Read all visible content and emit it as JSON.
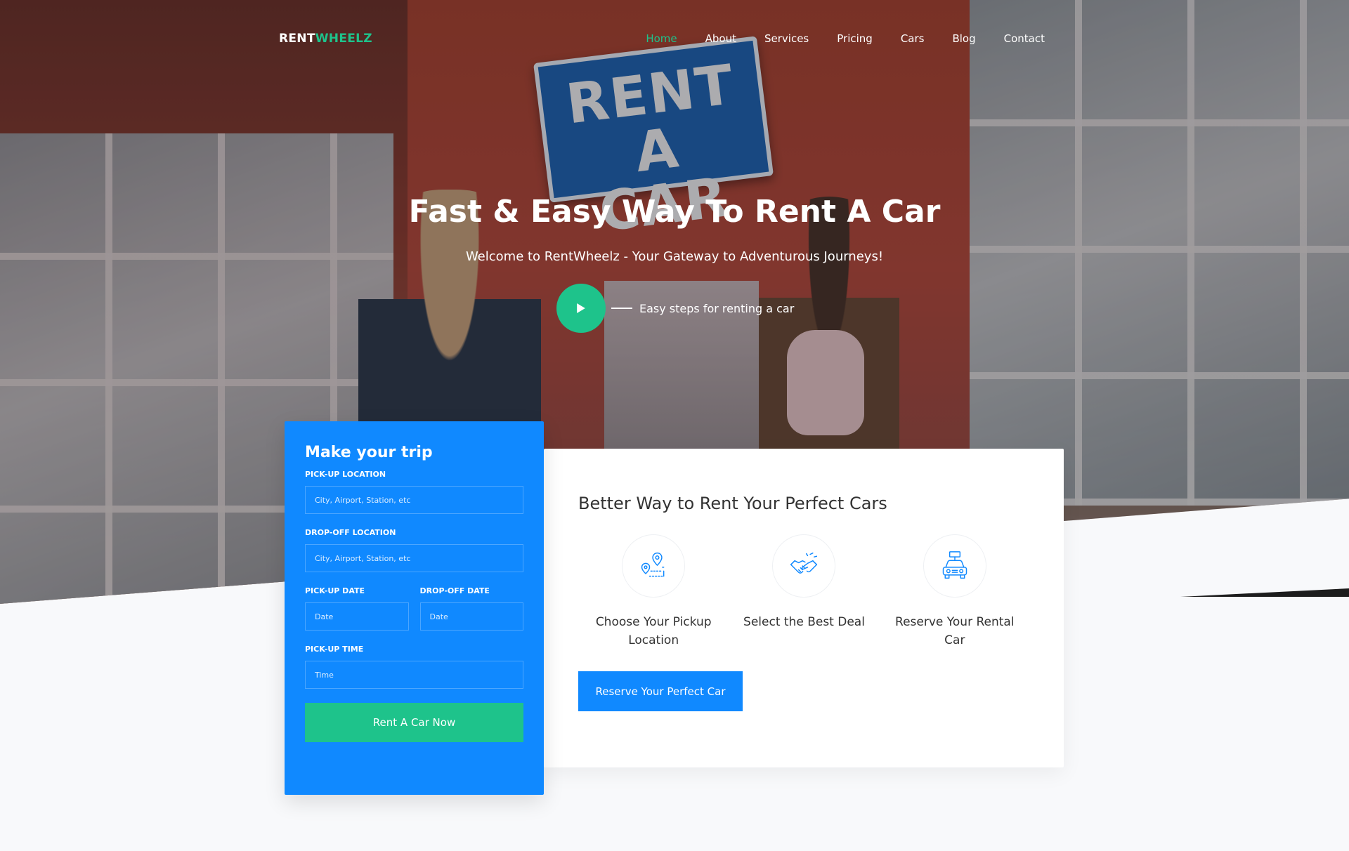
{
  "brand": {
    "name_part1": "RENT",
    "name_part2": "WHEELZ"
  },
  "nav": {
    "items": [
      {
        "label": "Home",
        "active": true
      },
      {
        "label": "About"
      },
      {
        "label": "Services"
      },
      {
        "label": "Pricing"
      },
      {
        "label": "Cars"
      },
      {
        "label": "Blog"
      },
      {
        "label": "Contact"
      }
    ]
  },
  "hero": {
    "sign_line1": "RENT",
    "sign_line2": "A CAR",
    "title": "Fast & Easy Way To Rent A Car",
    "subtitle": "Welcome to RentWheelz - Your Gateway to Adventurous Journeys!",
    "video_text": "Easy steps for renting a car",
    "play_icon": "play-icon"
  },
  "trip_form": {
    "title": "Make your trip",
    "pickup_location_label": "PICK-UP LOCATION",
    "pickup_location_placeholder": "City, Airport, Station, etc",
    "dropoff_location_label": "DROP-OFF LOCATION",
    "dropoff_location_placeholder": "City, Airport, Station, etc",
    "pickup_date_label": "PICK-UP DATE",
    "pickup_date_placeholder": "Date",
    "dropoff_date_label": "DROP-OFF DATE",
    "dropoff_date_placeholder": "Date",
    "pickup_time_label": "PICK-UP TIME",
    "pickup_time_placeholder": "Time",
    "submit_label": "Rent A Car Now"
  },
  "steps": {
    "title": "Better Way to Rent Your Perfect Cars",
    "items": [
      {
        "label": "Choose Your Pickup Location",
        "icon": "map-pin-route-icon"
      },
      {
        "label": "Select the Best Deal",
        "icon": "handshake-icon"
      },
      {
        "label": "Reserve Your Rental Car",
        "icon": "rent-car-icon"
      }
    ],
    "button_label": "Reserve Your Perfect Car"
  },
  "colors": {
    "accent_green": "#1ec38b",
    "primary_blue": "#1089ff",
    "background": "#f8f9fb"
  }
}
